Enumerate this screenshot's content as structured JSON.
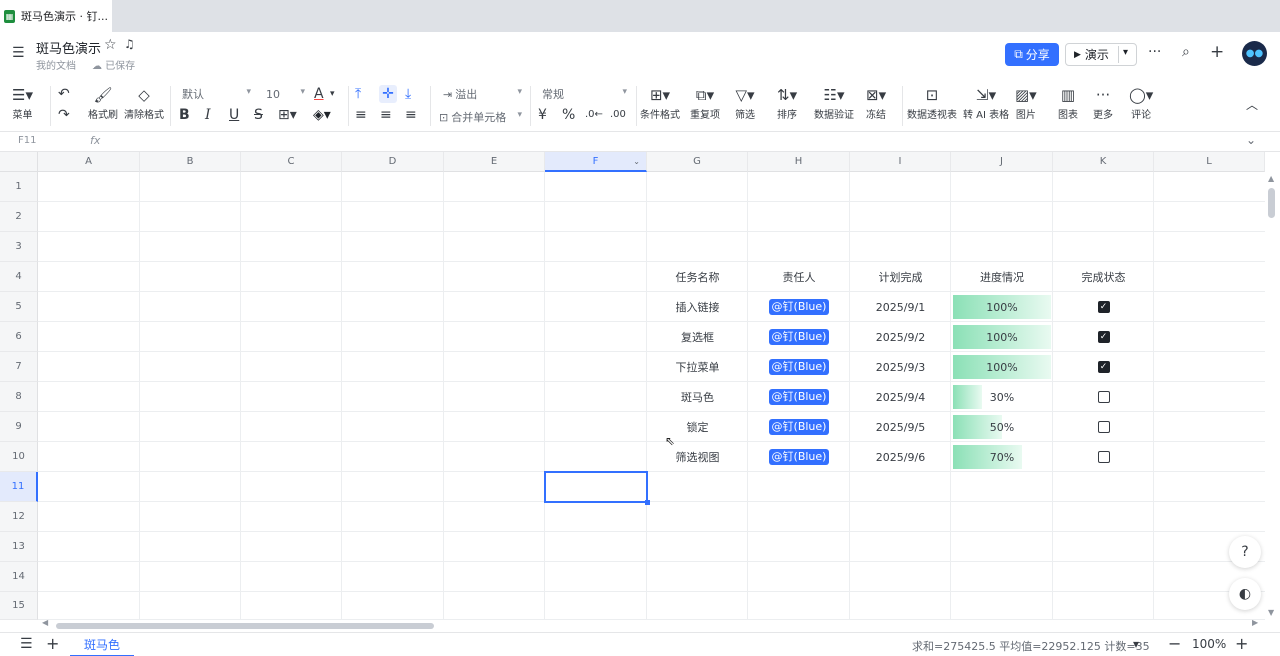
{
  "browser": {
    "tab_title": "斑马色演示 · 钉..."
  },
  "header": {
    "title": "斑马色演示",
    "location": "我的文档",
    "saved": "已保存",
    "share": "分享",
    "present": "演示"
  },
  "toolbar": {
    "menu": "菜单",
    "format_painter": "格式刷",
    "clear_format": "清除格式",
    "font": "默认",
    "size": "10",
    "overflow": "溢出",
    "merge": "合并单元格",
    "number_format": "常规",
    "cond_format": "条件格式",
    "duplicates": "重复项",
    "filter": "筛选",
    "sort": "排序",
    "validation": "数据验证",
    "freeze": "冻结",
    "pivot": "数据透视表",
    "ai_table": "转 AI 表格",
    "image": "图片",
    "chart": "图表",
    "more": "更多",
    "comment": "评论"
  },
  "formula_bar": {
    "cell_ref": "F11",
    "fx": "fx"
  },
  "columns": [
    "A",
    "B",
    "C",
    "D",
    "E",
    "F",
    "G",
    "H",
    "I",
    "J",
    "K",
    "L"
  ],
  "rows": [
    "1",
    "2",
    "3",
    "4",
    "5",
    "6",
    "7",
    "8",
    "9",
    "10",
    "11",
    "12",
    "13",
    "14",
    "15"
  ],
  "table": {
    "headers": [
      "任务名称",
      "责任人",
      "计划完成",
      "进度情况",
      "完成状态"
    ],
    "rows": [
      {
        "task": "插入链接",
        "owner": "@钉(Blue)",
        "date": "2025/9/1",
        "progress": "100%",
        "pct": 1.0,
        "done": true
      },
      {
        "task": "复选框",
        "owner": "@钉(Blue)",
        "date": "2025/9/2",
        "progress": "100%",
        "pct": 1.0,
        "done": true
      },
      {
        "task": "下拉菜单",
        "owner": "@钉(Blue)",
        "date": "2025/9/3",
        "progress": "100%",
        "pct": 1.0,
        "done": true
      },
      {
        "task": "斑马色",
        "owner": "@钉(Blue)",
        "date": "2025/9/4",
        "progress": "30%",
        "pct": 0.3,
        "done": false
      },
      {
        "task": "锁定",
        "owner": "@钉(Blue)",
        "date": "2025/9/5",
        "progress": "50%",
        "pct": 0.5,
        "done": false
      },
      {
        "task": "筛选视图",
        "owner": "@钉(Blue)",
        "date": "2025/9/6",
        "progress": "70%",
        "pct": 0.7,
        "done": false
      }
    ]
  },
  "statusbar": {
    "sheet": "斑马色",
    "stats": "求和=275425.5 平均值=22952.125 计数=35",
    "zoom": "100%"
  },
  "colors": {
    "accent": "#3370ff",
    "bar": "#8be0b6"
  }
}
